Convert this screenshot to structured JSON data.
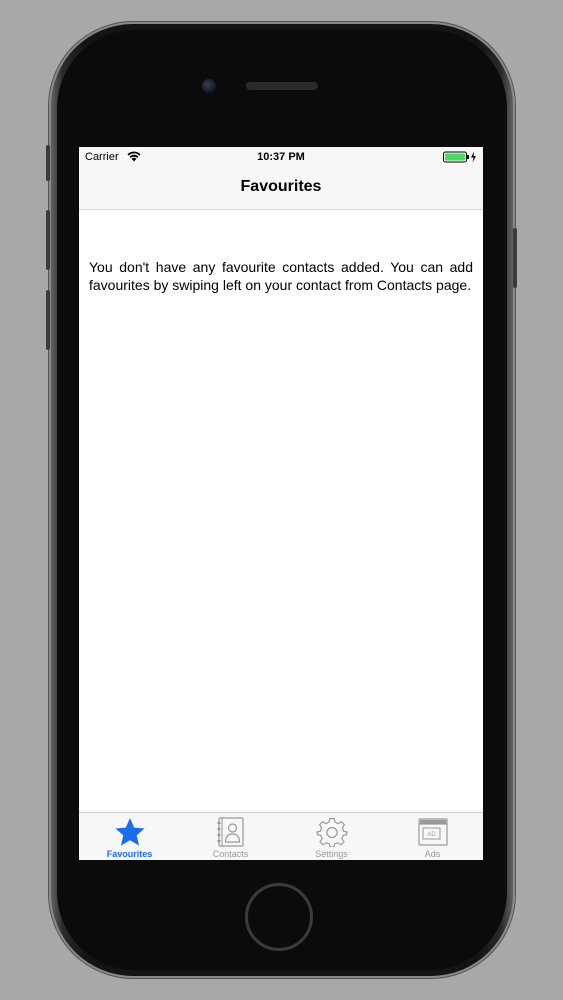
{
  "status_bar": {
    "carrier": "Carrier",
    "time": "10:37 PM",
    "battery_color": "#4cd964"
  },
  "nav": {
    "title": "Favourites"
  },
  "main": {
    "empty_message": "You don't have any favourite contacts added. You can add favourites by swiping left on your contact from Contacts page."
  },
  "tab_bar": {
    "active_color": "#1e6de8",
    "inactive_color": "#999999",
    "items": [
      {
        "label": "Favourites",
        "icon": "star-icon",
        "active": true
      },
      {
        "label": "Contacts",
        "icon": "contacts-book-icon",
        "active": false
      },
      {
        "label": "Settings",
        "icon": "gear-icon",
        "active": false
      },
      {
        "label": "Ads",
        "icon": "ad-window-icon",
        "active": false
      }
    ]
  }
}
